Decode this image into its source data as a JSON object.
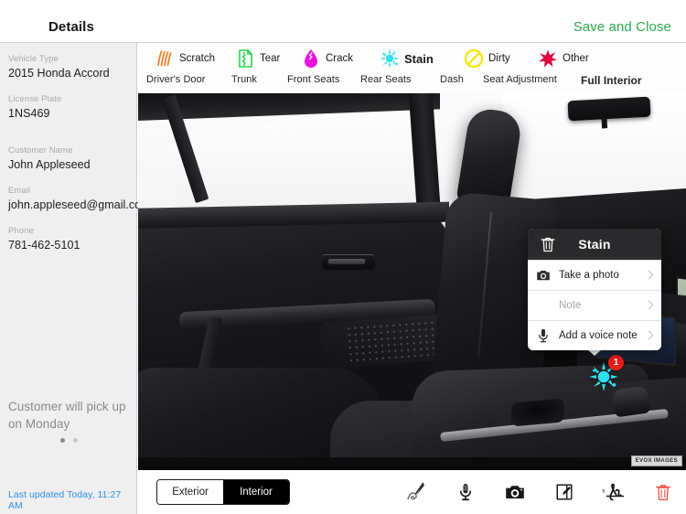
{
  "header": {
    "title": "Details",
    "save_label": "Save and Close"
  },
  "sidebar": {
    "fields": [
      {
        "label": "Vehicle Type",
        "value": "2015 Honda Accord"
      },
      {
        "label": "License Plate",
        "value": "1NS469"
      },
      {
        "label": "Customer Name",
        "value": "John Appleseed"
      },
      {
        "label": "Email",
        "value": "john.appleseed@gmail.com"
      },
      {
        "label": "Phone",
        "value": "781-462-5101"
      }
    ],
    "note": "Customer will pick up on Monday",
    "page_dots": {
      "count": 2,
      "active_index": 0
    },
    "last_updated": "Last updated Today, 11:27 AM"
  },
  "damage_bar": {
    "types": [
      {
        "label": "Scratch",
        "icon": "scratch-icon",
        "color": "#f07b1f",
        "selected": false
      },
      {
        "label": "Tear",
        "icon": "tear-icon",
        "color": "#28d44a",
        "selected": false
      },
      {
        "label": "Crack",
        "icon": "crack-icon",
        "color": "#e914e0",
        "selected": false
      },
      {
        "label": "Stain",
        "icon": "stain-icon",
        "color": "#2ee0f0",
        "selected": true
      },
      {
        "label": "Dirty",
        "icon": "dirty-icon",
        "color": "#f5e717",
        "selected": false
      },
      {
        "label": "Other",
        "icon": "other-icon",
        "color": "#e0063c",
        "selected": false
      }
    ],
    "areas": [
      {
        "label": "Driver's Door",
        "selected": false
      },
      {
        "label": "Trunk",
        "selected": false
      },
      {
        "label": "Front Seats",
        "selected": false
      },
      {
        "label": "Rear Seats",
        "selected": false
      },
      {
        "label": "Dash",
        "selected": false
      },
      {
        "label": "Seat Adjustment",
        "selected": false
      },
      {
        "label": "Full Interior",
        "selected": true
      }
    ]
  },
  "canvas": {
    "watermark": "EVOX IMAGES",
    "marker": {
      "type": "stain-marker",
      "badge_count": "1",
      "color": "#2ee0f0",
      "badge_color": "#e8201a"
    }
  },
  "popover": {
    "title": "Stain",
    "delete_icon": "trash-icon",
    "rows": [
      {
        "label": "Take a photo",
        "icon": "camera-icon",
        "muted": false
      },
      {
        "label": "Note",
        "icon": "",
        "muted": true
      },
      {
        "label": "Add a voice note",
        "icon": "microphone-icon",
        "muted": false
      }
    ]
  },
  "bottom_bar": {
    "segments": [
      {
        "label": "Exterior",
        "selected": false
      },
      {
        "label": "Interior",
        "selected": true
      }
    ],
    "tools": [
      {
        "name": "draw-pen-icon"
      },
      {
        "name": "microphone-icon"
      },
      {
        "name": "camera-icon"
      },
      {
        "name": "note-edit-icon"
      },
      {
        "name": "signature-icon"
      },
      {
        "name": "trash-icon"
      }
    ]
  }
}
